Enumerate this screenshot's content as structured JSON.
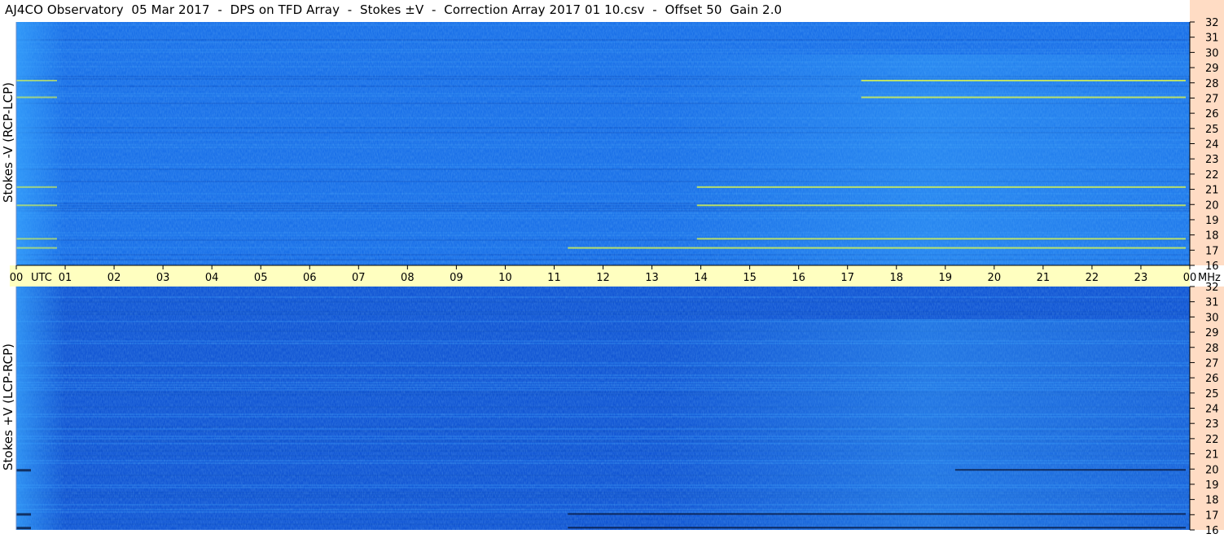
{
  "title": "AJ4CO Observatory  05 Mar 2017  -  DPS on TFD Array  -  Stokes ±V  -  Correction Array 2017 01 10.csv  -  Offset 50  Gain 2.0",
  "colors": {
    "panel_base": "#1a70e8",
    "panel_bottom_base": "#1256d4",
    "time_axis_bg": "#ffffc0",
    "freq_axis_bg": "#ffdcc4",
    "hot_line": "#e8ff40",
    "dark_line": "#0a1a40"
  },
  "chart_data": [
    {
      "type": "heatmap",
      "name_label": "Stokes -V (RCP-LCP)",
      "ylabel": "Stokes -V (RCP-LCP)",
      "yticks": [
        32,
        31,
        30,
        29,
        28,
        27,
        26,
        25,
        24,
        23,
        22,
        21,
        20,
        19,
        18,
        17,
        16
      ],
      "ylim": [
        16,
        32
      ],
      "yunit": "MHz",
      "colormap": "blue-cyan-yellow",
      "bright_bands_mhz": [
        21.2,
        20.0,
        17.8,
        17.2,
        28.2,
        27.1
      ]
    },
    {
      "type": "heatmap",
      "name_label": "Stokes +V (LCP-RCP)",
      "ylabel": "Stokes +V (LCP-RCP)",
      "yticks": [
        32,
        31,
        30,
        29,
        28,
        27,
        26,
        25,
        24,
        23,
        22,
        21,
        20,
        19,
        18,
        17,
        16
      ],
      "ylim": [
        16,
        32
      ],
      "yunit": "MHz",
      "colormap": "blue-cyan-yellow",
      "dark_bands_mhz": [
        20.0,
        17.1,
        16.2
      ]
    }
  ],
  "time_axis": {
    "labels": [
      "00",
      "01",
      "02",
      "03",
      "04",
      "05",
      "06",
      "07",
      "08",
      "09",
      "10",
      "11",
      "12",
      "13",
      "14",
      "15",
      "16",
      "17",
      "18",
      "19",
      "20",
      "21",
      "22",
      "23",
      "00"
    ],
    "utc_label": "UTC",
    "unit_label": "MHz",
    "range_hours": [
      0,
      24
    ]
  }
}
